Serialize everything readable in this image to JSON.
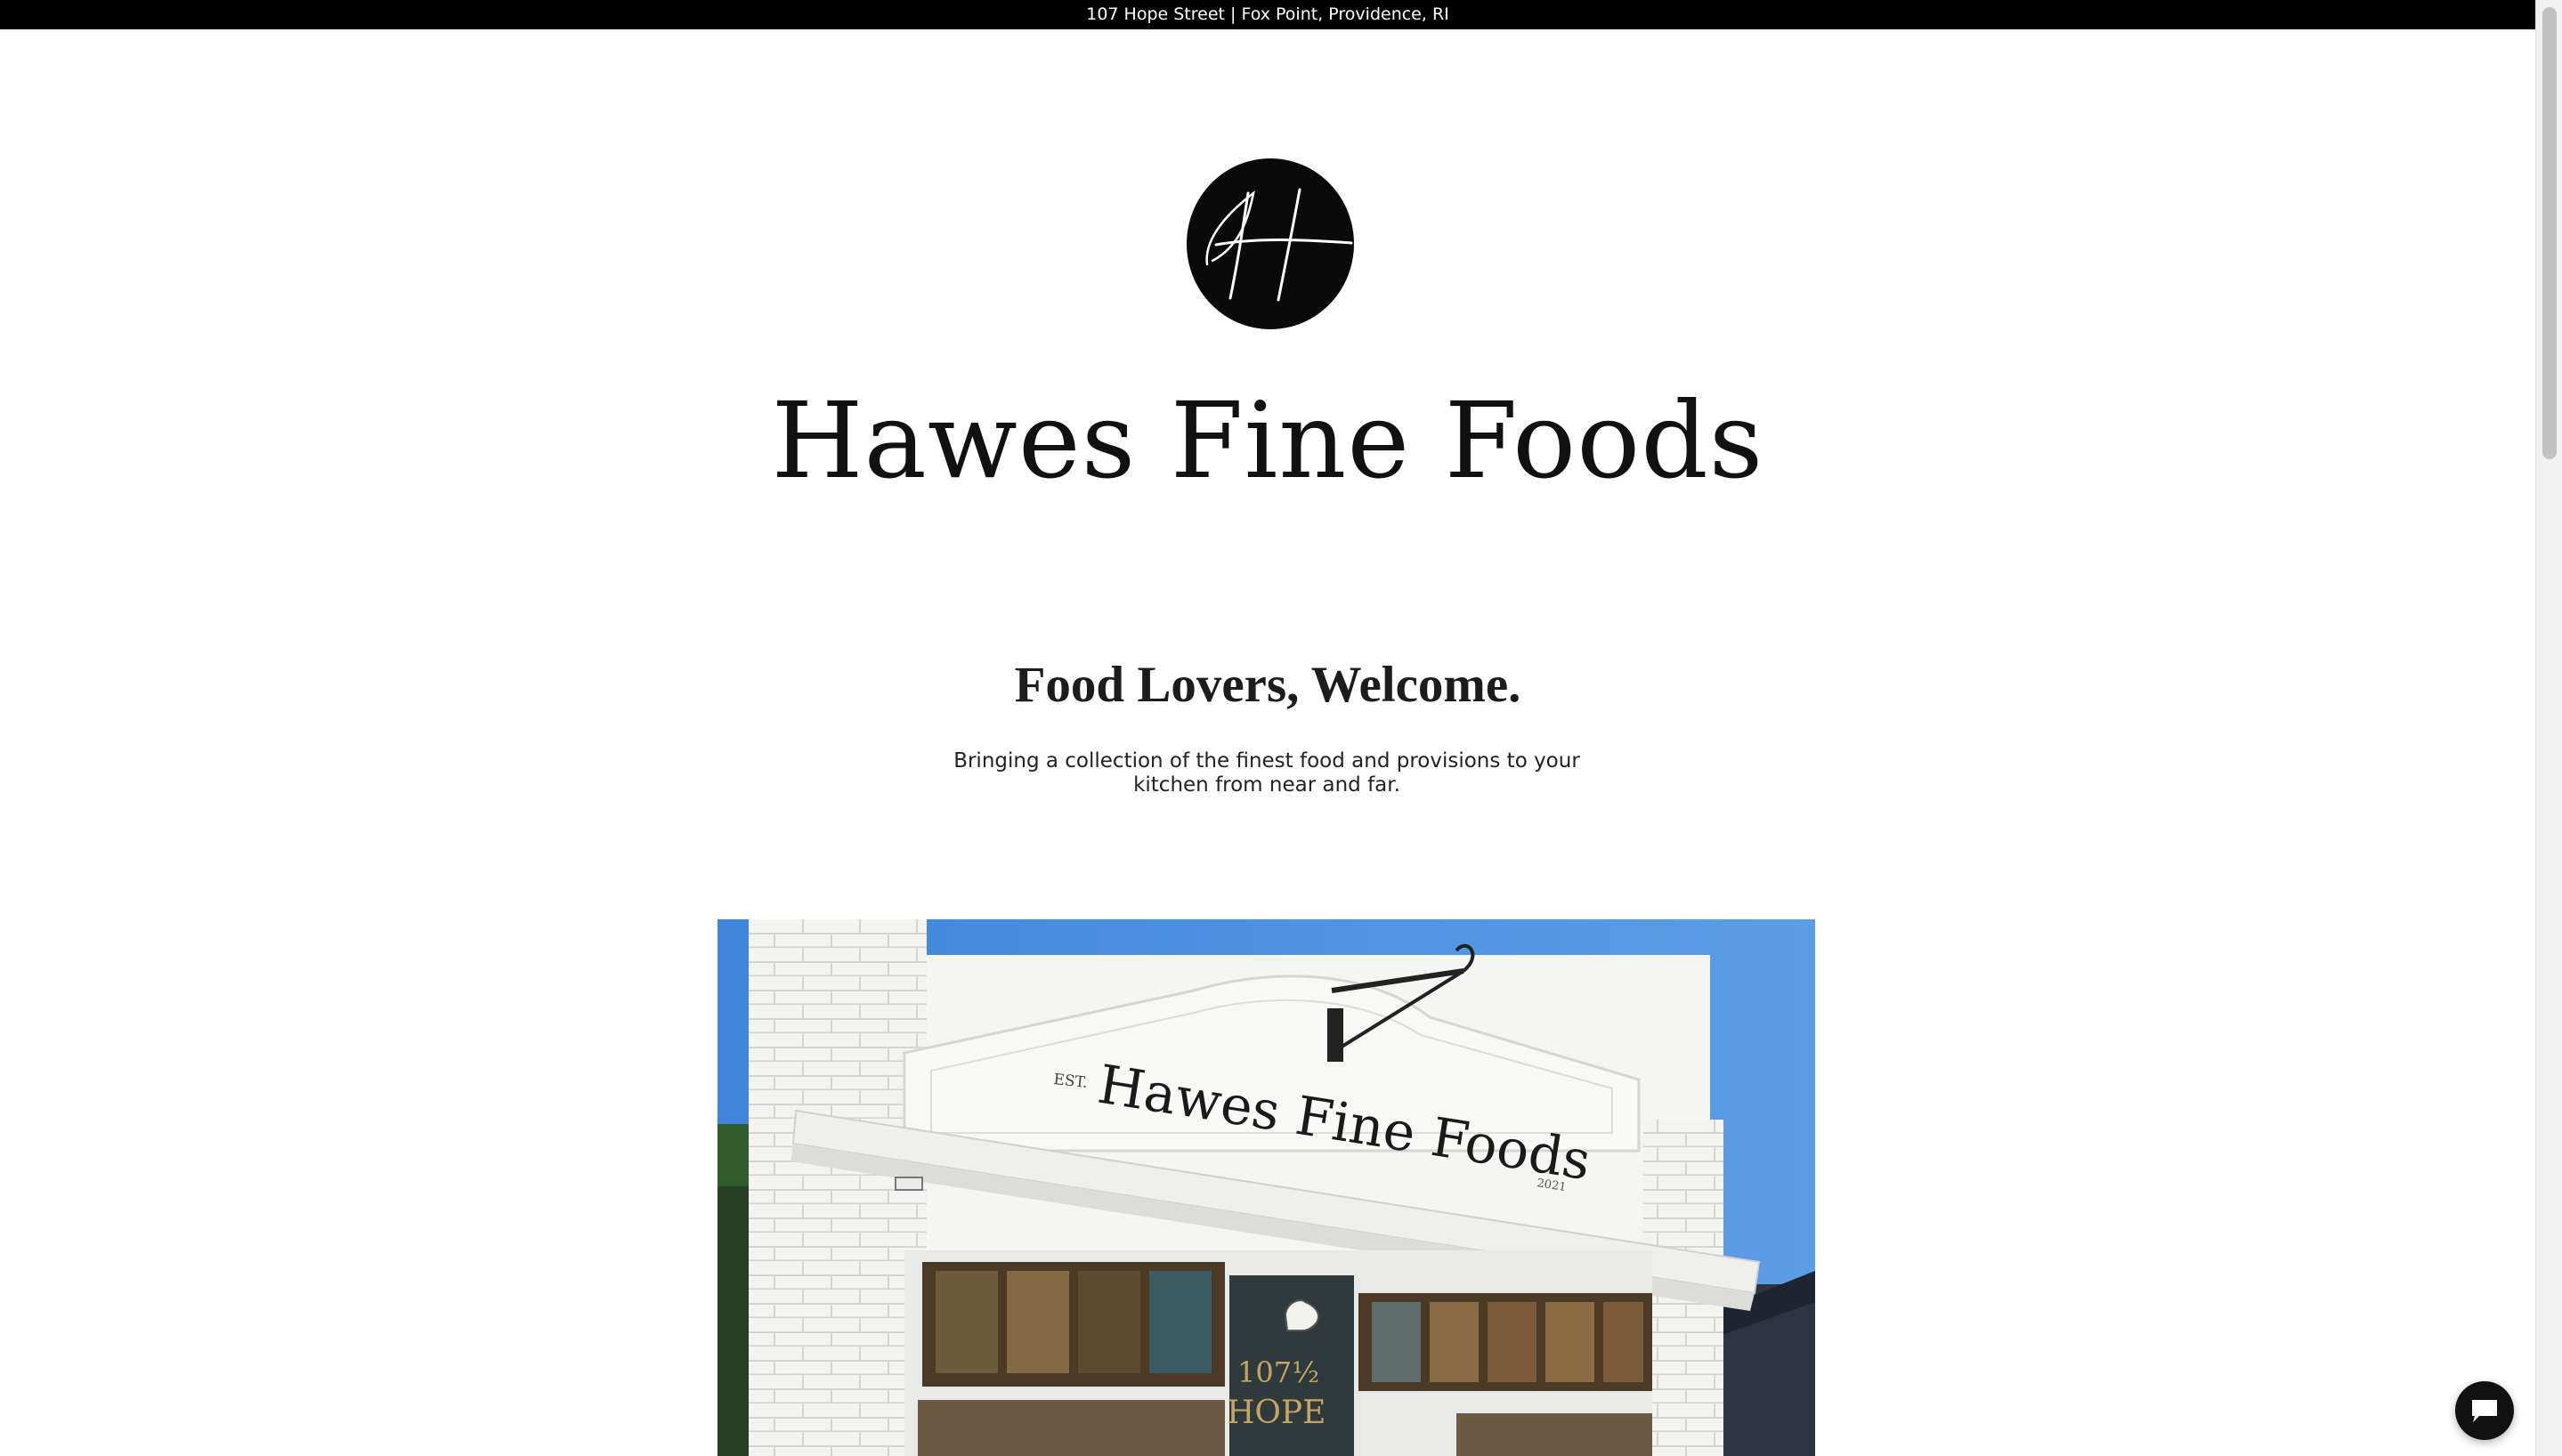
{
  "announcement": {
    "text": "107 Hope Street | Fox Point, Providence, RI"
  },
  "brand": {
    "name": "Hawes Fine Foods",
    "logo_icon": "hf-monogram-logo"
  },
  "welcome": {
    "heading": "Food Lovers, Welcome.",
    "body": "Bringing a collection of the finest food and provisions to your kitchen from near and far."
  },
  "hero": {
    "sign_text": "Hawes Fine Foods",
    "sign_est": "EST.",
    "sign_year": "2021",
    "door_number": "107½",
    "door_street": "HOPE"
  },
  "chat": {
    "icon": "chat-bubble-icon"
  },
  "colors": {
    "bar": "#000000",
    "sky": "#4a8fdf",
    "building": "#f4f4f2",
    "text": "#111111"
  }
}
